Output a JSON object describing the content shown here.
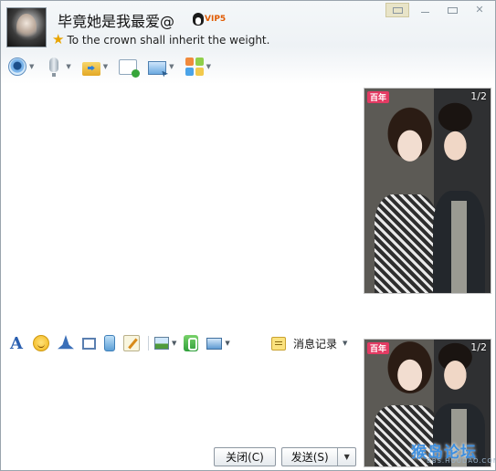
{
  "header": {
    "nickname": "毕竟她是我最爱@",
    "vip_label": "VIP5",
    "signature": "To the crown shall inherit the weight."
  },
  "window_controls": [
    "settings",
    "minimize",
    "maximize",
    "close"
  ],
  "top_toolbar": {
    "icons": [
      "video-call-icon",
      "voice-call-icon",
      "send-file-icon",
      "group-chat-icon",
      "remote-assist-icon",
      "app-center-icon"
    ]
  },
  "photo_1": {
    "page": "1/2",
    "tag": "百年"
  },
  "photo_2": {
    "page": "1/2",
    "tag": "百年"
  },
  "input_toolbar": {
    "icons": [
      "font-icon",
      "emoticon-icon",
      "shake-icon",
      "screenshot-icon",
      "voice-message-icon",
      "scrawl-icon",
      "image-icon",
      "music-icon",
      "screen-share-icon"
    ],
    "history_label": "消息记录"
  },
  "buttons": {
    "close_label": "关闭(C)",
    "send_label": "发送(S)"
  },
  "watermark": {
    "title": "猴岛论坛",
    "url": "BBS.HOUDAO.COM"
  },
  "colors": {
    "accent": "#3d8fe0",
    "vip": "#e05a00",
    "tag": "#e33b63"
  }
}
